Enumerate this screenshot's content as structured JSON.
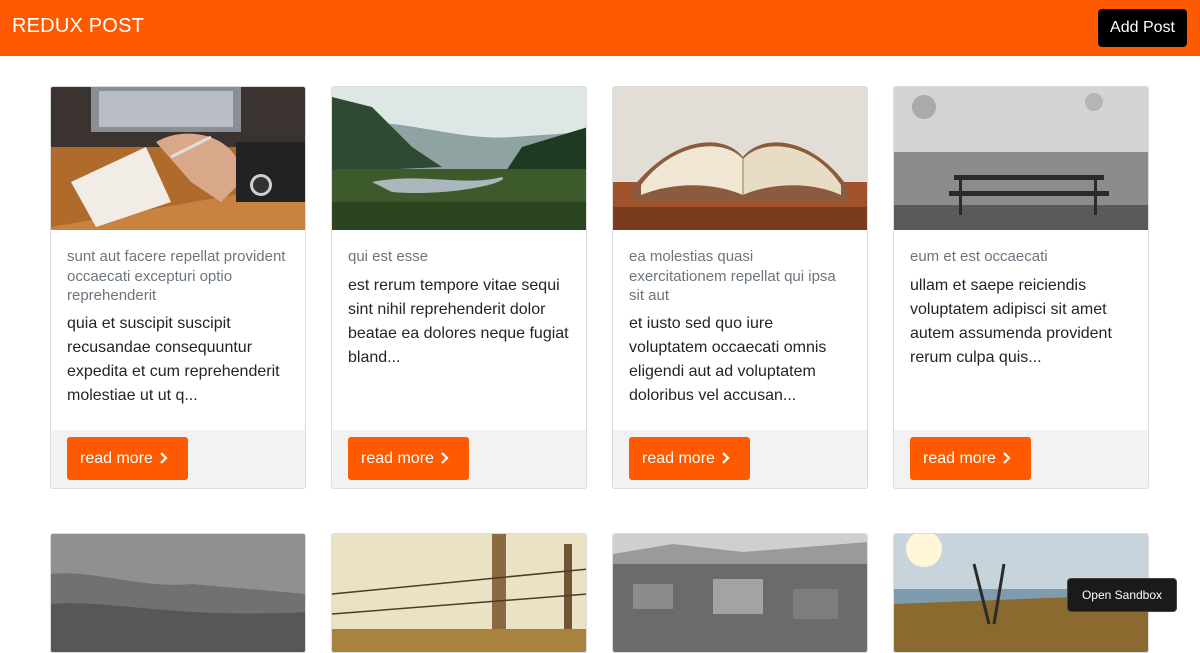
{
  "navbar": {
    "brand": "REDUX POST",
    "add_post_label": "Add Post"
  },
  "posts": [
    {
      "title": "sunt aut facere repellat provident occaecati excepturi optio reprehenderit",
      "body": "quia et suscipit suscipit recusandae consequuntur expedita et cum reprehenderit molestiae ut ut q...",
      "read_more": "read more",
      "image": "laptop-writing-photo"
    },
    {
      "title": "qui est esse",
      "body": "est rerum tempore vitae sequi sint nihil reprehenderit dolor beatae ea dolores neque fugiat bland...",
      "read_more": "read more",
      "image": "river-valley-photo"
    },
    {
      "title": "ea molestias quasi exercitationem repellat qui ipsa sit aut",
      "body": "et iusto sed quo iure voluptatem occaecati omnis eligendi aut ad voluptatem doloribus vel accusan...",
      "read_more": "read more",
      "image": "open-book-photo"
    },
    {
      "title": "eum et est occaecati",
      "body": "ullam et saepe reiciendis voluptatem adipisci sit amet autem assumenda provident rerum culpa quis...",
      "read_more": "read more",
      "image": "bench-wall-photo"
    }
  ],
  "second_row_images": [
    "foggy-coast-photo",
    "fence-posts-photo",
    "city-aerial-photo",
    "swing-sunset-photo"
  ],
  "sandbox_label": "Open Sandbox",
  "colors": {
    "accent": "#ff5a00",
    "dark": "#000000",
    "footer_bg": "#f2f2f2"
  }
}
